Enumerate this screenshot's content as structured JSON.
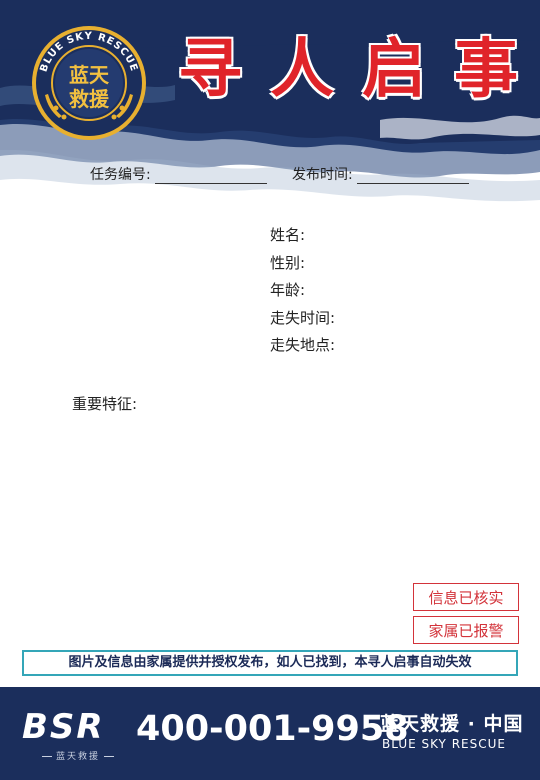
{
  "header": {
    "title_chars": [
      "寻",
      "人",
      "启",
      "事"
    ],
    "logo": {
      "ring_text": "BLUE SKY RESCUE",
      "line1": "蓝天",
      "line2": "救援"
    },
    "colors": {
      "navy": "#1b2e5c",
      "title_red": "#e0242a",
      "gold": "#e8b030"
    }
  },
  "fields": {
    "task_number_label": "任务编号:",
    "publish_time_label": "发布时间:"
  },
  "info": {
    "name": "姓名:",
    "gender": "性别:",
    "age": "年龄:",
    "missing_time": "走失时间:",
    "missing_place": "走失地点:"
  },
  "features_label": "重要特征:",
  "badges": {
    "verified": "信息已核实",
    "reported": "家属已报警"
  },
  "notice": "图片及信息由家属提供并授权发布，如人已找到，本寻人启事自动失效",
  "footer": {
    "bsr": "BSR",
    "bsr_sub": "蓝天救援",
    "phone": "400-001-9958",
    "org_cn": "蓝天救援 · 中国",
    "org_en": "BLUE SKY RESCUE"
  }
}
